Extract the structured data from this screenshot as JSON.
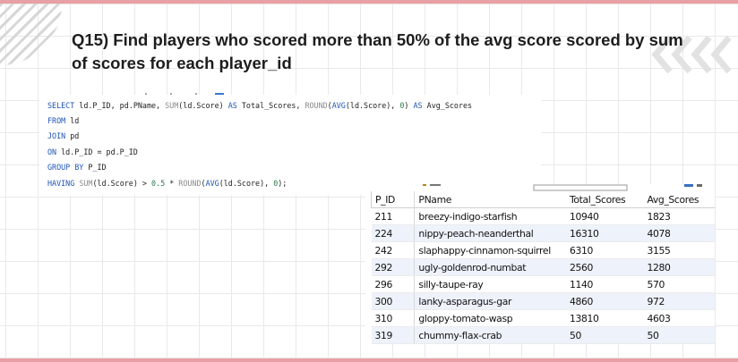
{
  "question": "Q15) Find players who scored more than 50% of the avg score scored by sum of scores for each player_id",
  "sql": {
    "line1": {
      "kw1": "SELECT",
      "t1": " ld.P_ID, pd.PName, ",
      "fn1": "SUM",
      "t2": "(ld.Score) ",
      "kw2": "AS",
      "t3": " Total_Scores, ",
      "fn2": "ROUND",
      "t4": "(",
      "kw3": "AVG",
      "t5": "(ld.Score), ",
      "n1": "0",
      "t6": ") ",
      "kw4": "AS",
      "t7": " Avg_Scores"
    },
    "line2": {
      "kw": "FROM",
      "t": " ld"
    },
    "line3": {
      "kw": "JOIN",
      "t": " pd"
    },
    "line4": {
      "kw": "ON",
      "t": " ld.P_ID = pd.P_ID"
    },
    "line5": {
      "kw": "GROUP BY",
      "t": " P_ID"
    },
    "line6": {
      "kw1": "HAVING",
      "t1": " ",
      "fn1": "SUM",
      "t2": "(ld.Score) > ",
      "n1": "0.5",
      "t3": " * ",
      "fn2": "ROUND",
      "t4": "(",
      "kw2": "AVG",
      "t5": "(ld.Score), ",
      "n2": "0",
      "t6": ");"
    }
  },
  "result": {
    "headers": [
      "P_ID",
      "PName",
      "Total_Scores",
      "Avg_Scores"
    ],
    "rows": [
      [
        "211",
        "breezy-indigo-starfish",
        "10940",
        "1823"
      ],
      [
        "224",
        "nippy-peach-neanderthal",
        "16310",
        "4078"
      ],
      [
        "242",
        "slaphappy-cinnamon-squirrel",
        "6310",
        "3155"
      ],
      [
        "292",
        "ugly-goldenrod-numbat",
        "2560",
        "1280"
      ],
      [
        "296",
        "silly-taupe-ray",
        "1140",
        "570"
      ],
      [
        "300",
        "lanky-asparagus-gar",
        "4860",
        "972"
      ],
      [
        "310",
        "gloppy-tomato-wasp",
        "13810",
        "4603"
      ],
      [
        "319",
        "chummy-flax-crab",
        "50",
        "50"
      ]
    ]
  },
  "colors": {
    "keyword": "#1f55b4",
    "function": "#8a8a8a",
    "number": "#2a7a4a",
    "accent_line": "#e8a0a6",
    "row_alt": "#eef2fb"
  },
  "icons": {
    "decor_right": "chevrons-left-icon",
    "decor_left": "diagonal-stripes"
  }
}
